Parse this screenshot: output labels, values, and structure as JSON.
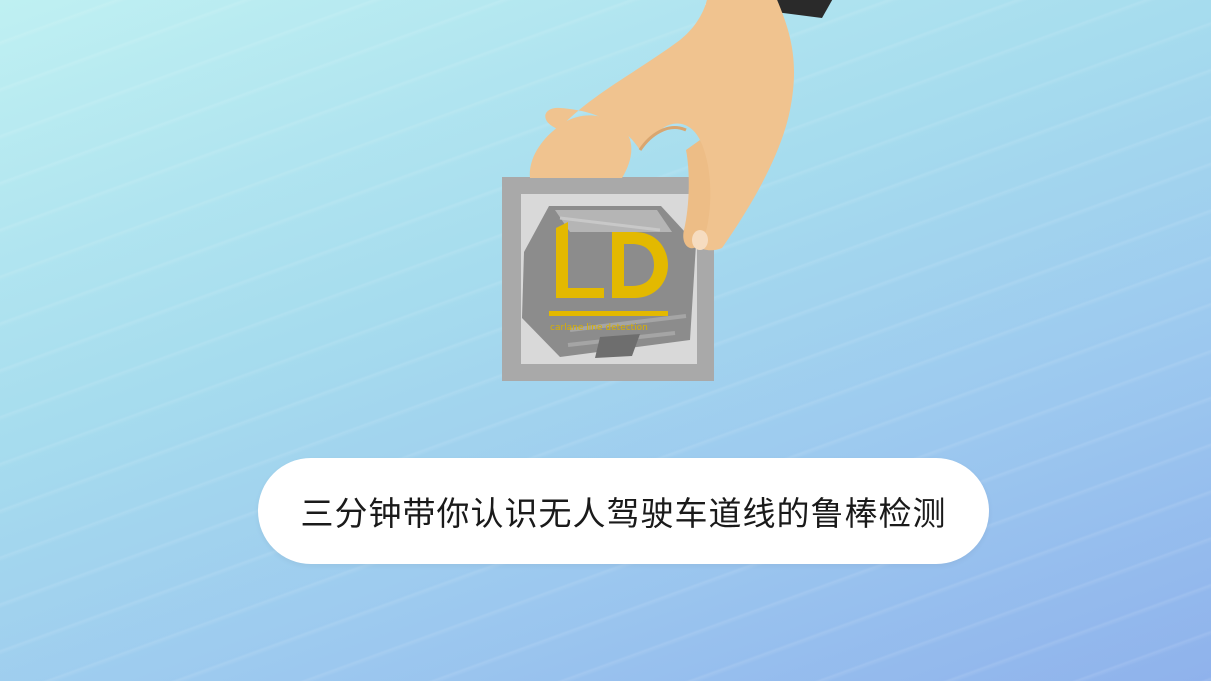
{
  "caption": {
    "text": "三分钟带你认识无人驾驶车道线的鲁棒检测"
  },
  "logo": {
    "letters": "LD",
    "tagline": "carlane line detection"
  },
  "colors": {
    "background_top": "#bff0f2",
    "background_bottom": "#8fb2ec",
    "skin": "#f0c38f",
    "frame": "#a9a9a9",
    "logo_yellow": "#e3b900",
    "cube_gray": "#8a8a8a"
  }
}
